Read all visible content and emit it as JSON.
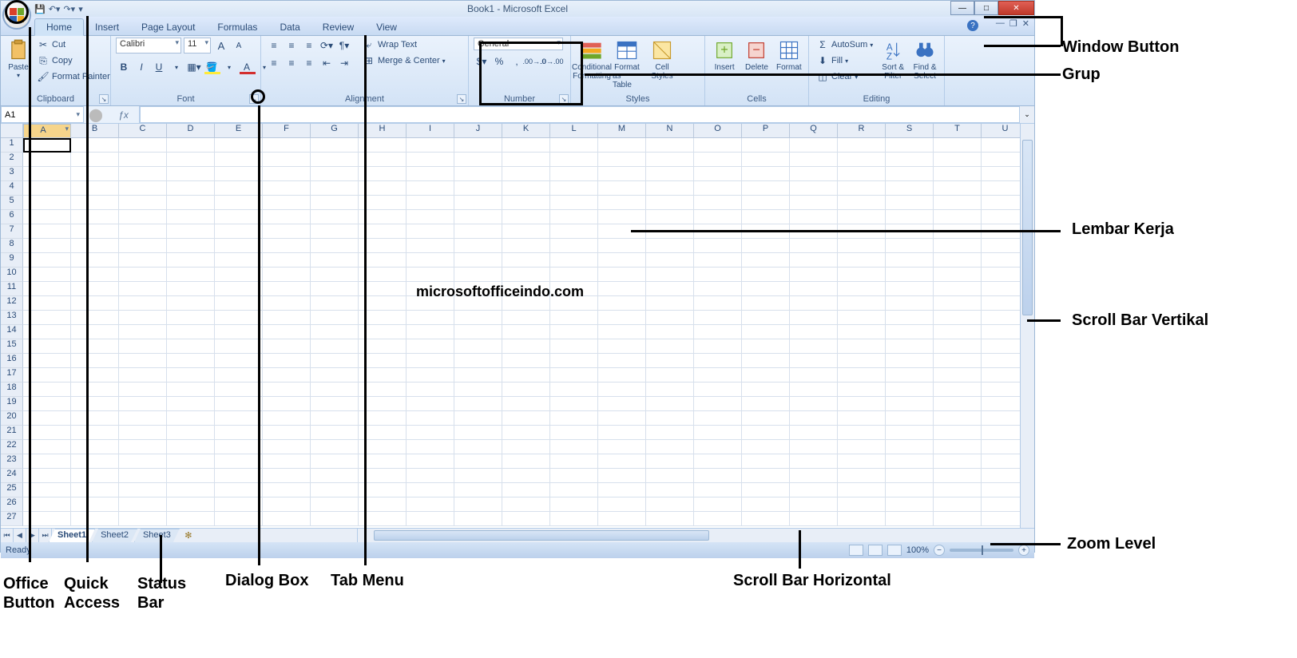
{
  "title": "Book1 - Microsoft Excel",
  "tabs": [
    "Home",
    "Insert",
    "Page Layout",
    "Formulas",
    "Data",
    "Review",
    "View"
  ],
  "active_tab": 0,
  "clipboard": {
    "paste": "Paste",
    "cut": "Cut",
    "copy": "Copy",
    "format_painter": "Format Painter",
    "title": "Clipboard"
  },
  "font": {
    "name": "Calibri",
    "size": "11",
    "bold": "B",
    "italic": "I",
    "underline": "U",
    "title": "Font"
  },
  "alignment": {
    "wrap": "Wrap Text",
    "merge": "Merge & Center",
    "title": "Alignment"
  },
  "number": {
    "format": "General",
    "percent": "%",
    "comma": ",",
    "title": "Number"
  },
  "styles": {
    "cond": "Conditional",
    "cond2": "Formatting",
    "fmt": "Format",
    "fmt2": "as Table",
    "cell": "Cell",
    "cell2": "Styles",
    "title": "Styles"
  },
  "cells_grp": {
    "insert": "Insert",
    "delete": "Delete",
    "format": "Format",
    "title": "Cells"
  },
  "editing": {
    "autosum": "AutoSum",
    "fill": "Fill",
    "clear": "Clear",
    "sort": "Sort &",
    "sort2": "Filter",
    "find": "Find &",
    "find2": "Select",
    "title": "Editing"
  },
  "name_box": "A1",
  "columns": [
    "A",
    "B",
    "C",
    "D",
    "E",
    "F",
    "G",
    "H",
    "I",
    "J",
    "K",
    "L",
    "M",
    "N",
    "O",
    "P",
    "Q",
    "R",
    "S",
    "T",
    "U"
  ],
  "rows": [
    "1",
    "2",
    "3",
    "4",
    "5",
    "6",
    "7",
    "8",
    "9",
    "10",
    "11",
    "12",
    "13",
    "14",
    "15",
    "16",
    "17",
    "18",
    "19",
    "20",
    "21",
    "22",
    "23",
    "24",
    "25",
    "26",
    "27"
  ],
  "sheets": [
    "Sheet1",
    "Sheet2",
    "Sheet3"
  ],
  "active_sheet": 0,
  "status": "Ready",
  "zoom": "100%",
  "watermark": "microsoftofficeindo.com",
  "callouts": {
    "window_button": "Window Button",
    "grup": "Grup",
    "lembar_kerja": "Lembar Kerja",
    "scroll_v": "Scroll Bar Vertikal",
    "zoom_level": "Zoom Level",
    "office_button": "Office",
    "office_button2": "Button",
    "quick_access": "Quick",
    "quick_access2": "Access",
    "status_bar": "Status",
    "status_bar2": "Bar",
    "dialog_box": "Dialog Box",
    "tab_menu": "Tab Menu",
    "scroll_h": "Scroll Bar Horizontal"
  }
}
